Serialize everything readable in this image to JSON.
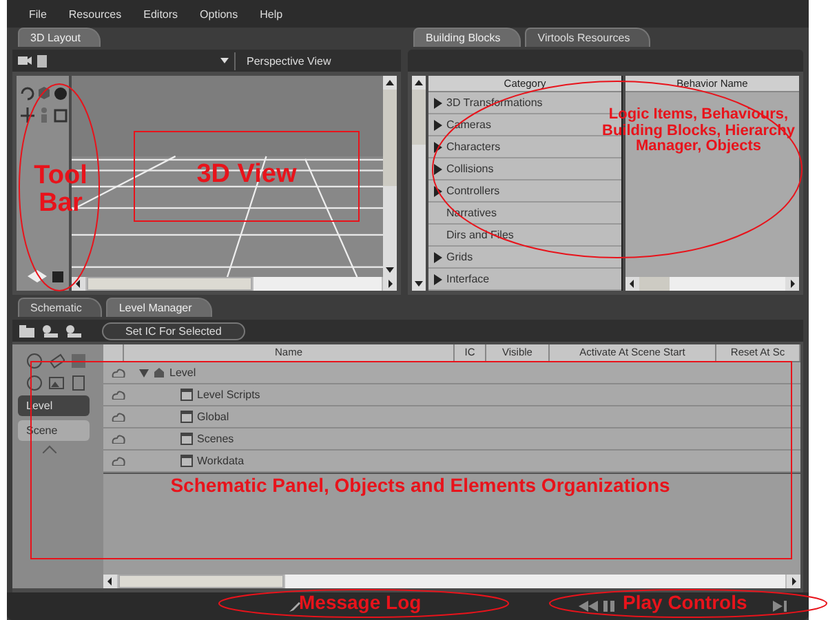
{
  "menu": [
    "File",
    "Resources",
    "Editors",
    "Options",
    "Help"
  ],
  "layout_panel": {
    "tabs": [
      {
        "label": "3D Layout",
        "selected": true
      }
    ],
    "view_label": "Perspective View"
  },
  "blocks_panel": {
    "tabs": [
      {
        "label": "Building Blocks",
        "selected": true
      },
      {
        "label": "Virtools Resources",
        "selected": false
      }
    ],
    "columns": [
      "Category",
      "Behavior Name"
    ],
    "categories": [
      {
        "label": "3D Transformations",
        "expandable": true
      },
      {
        "label": "Cameras",
        "expandable": true
      },
      {
        "label": "Characters",
        "expandable": true
      },
      {
        "label": "Collisions",
        "expandable": true
      },
      {
        "label": "Controllers",
        "expandable": true
      },
      {
        "label": "Narratives",
        "expandable": false
      },
      {
        "label": "Dirs and Files",
        "expandable": false
      },
      {
        "label": "Grids",
        "expandable": true
      },
      {
        "label": "Interface",
        "expandable": true
      }
    ]
  },
  "schematic": {
    "tabs": [
      {
        "label": "Schematic",
        "selected": false
      },
      {
        "label": "Level Manager",
        "selected": true
      }
    ],
    "button": "Set IC For Selected",
    "side_tabs": [
      {
        "label": "Level",
        "selected": true
      },
      {
        "label": "Scene",
        "selected": false
      }
    ],
    "columns": [
      "Name",
      "IC",
      "Visible",
      "Activate At Scene Start",
      "Reset At Sc"
    ],
    "tree": [
      {
        "label": "Level",
        "expanded": true,
        "children": [
          {
            "label": "Level Scripts"
          },
          {
            "label": "Global"
          },
          {
            "label": "Scenes"
          },
          {
            "label": "Workdata"
          }
        ]
      }
    ]
  },
  "annotations": [
    {
      "kind": "ellipse",
      "text": "Tool Bar"
    },
    {
      "kind": "frame",
      "text": "3D View"
    },
    {
      "kind": "ellipse",
      "text": "Logic Items, Behaviours, Building Blocks, Hierarchy Manager, Objects"
    },
    {
      "kind": "frame",
      "text": "Schematic Panel, Objects and Elements Organizations"
    },
    {
      "kind": "ellipse",
      "text": "Message Log"
    },
    {
      "kind": "ellipse",
      "text": "Play Controls"
    }
  ]
}
